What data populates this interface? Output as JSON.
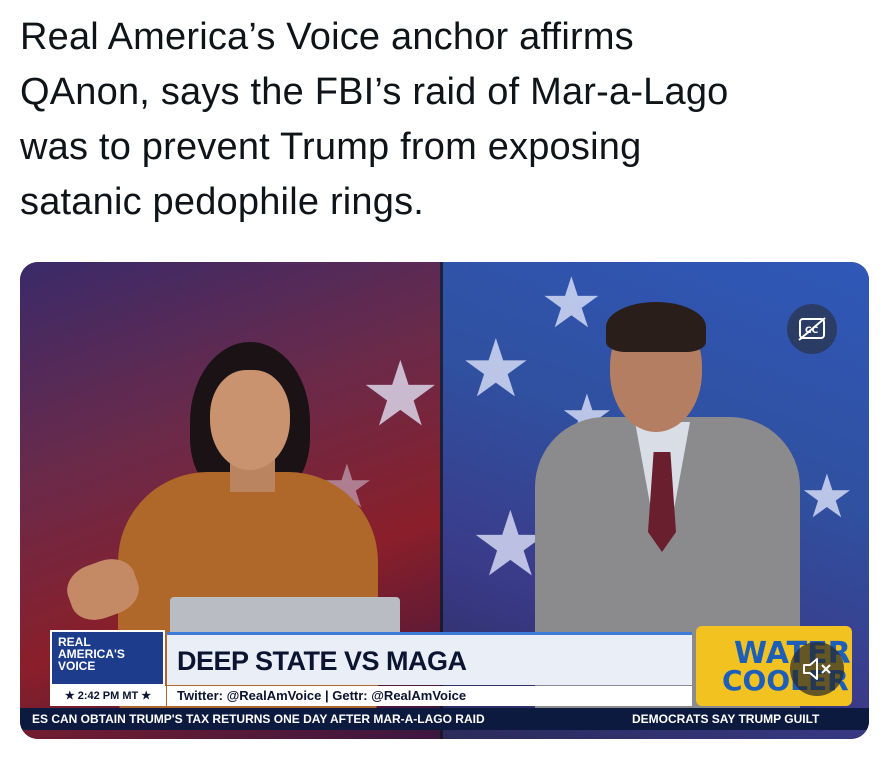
{
  "tweet": {
    "text_line1": "Real America’s Voice anchor affirms",
    "text_line2": "QAnon, says the FBI’s raid of Mar-a-Lago",
    "text_line3": "was to prevent Trump from exposing",
    "text_line4": "satanic pedophile rings."
  },
  "video": {
    "icons": {
      "captions": "closed-captions-icon",
      "mute": "speaker-muted-icon"
    },
    "lower_third": {
      "logo_line1": "REAL",
      "logo_line2": "AMERICA'S",
      "logo_line3": "VOICE",
      "headline": "DEEP STATE VS MAGA",
      "time": "★ 2:42 PM MT ★",
      "social": "Twitter: @RealAmVoice | Gettr: @RealAmVoice",
      "show_logo_line1": "WATER",
      "show_logo_line2": "COOLER"
    },
    "ticker": {
      "item1": "ES CAN OBTAIN TRUMP'S TAX RETURNS ONE DAY AFTER MAR-A-LAGO RAID",
      "item2": "DEMOCRATS SAY TRUMP GUILT"
    }
  },
  "colors": {
    "text": "#0f1419",
    "lower_third_blue": "#1d3c8c",
    "ticker_bg": "#0d1a3f",
    "show_logo_yellow": "#f2c220"
  }
}
